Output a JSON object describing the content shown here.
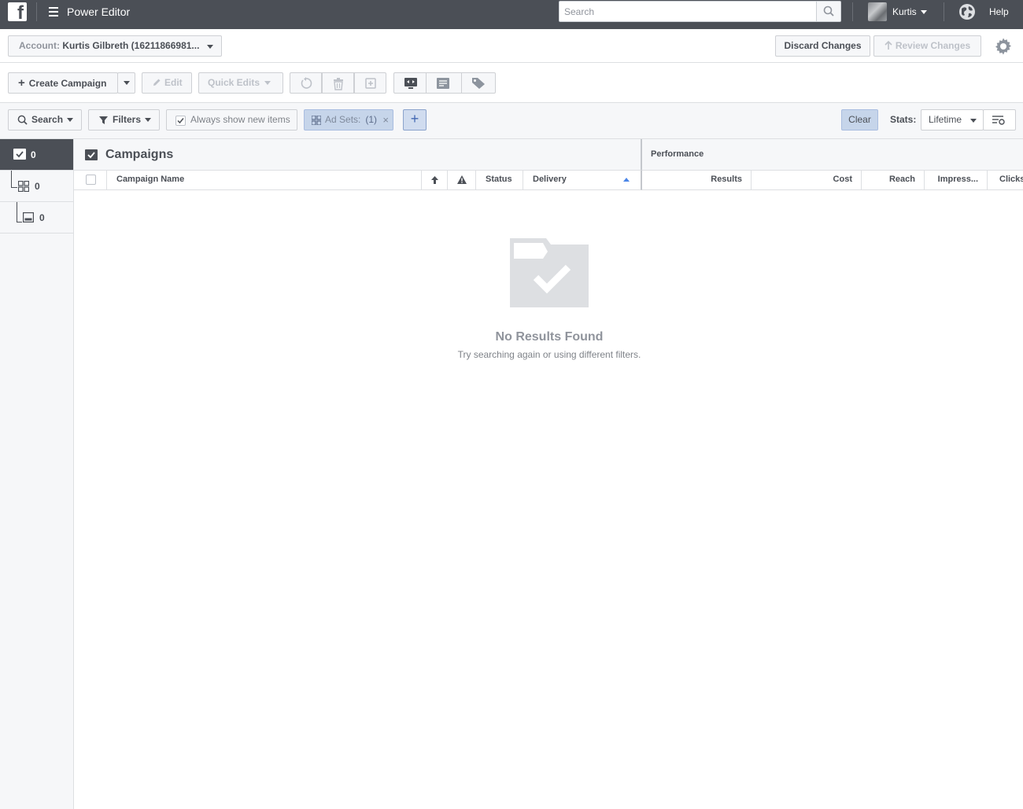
{
  "topbar": {
    "app_title": "Power Editor",
    "search_placeholder": "Search",
    "user_name": "Kurtis",
    "help": "Help"
  },
  "account": {
    "label": "Account:",
    "value": "Kurtis Gilbreth (16211866981...",
    "discard": "Discard Changes",
    "review": "Review Changes"
  },
  "toolbar": {
    "create": "Create Campaign",
    "edit": "Edit",
    "quick_edits": "Quick Edits"
  },
  "filterbar": {
    "search": "Search",
    "filters": "Filters",
    "always_show": "Always show new items",
    "always_show_checked": true,
    "chip_label": "Ad Sets:",
    "chip_count": "(1)",
    "chip_remove": "×",
    "add": "+",
    "clear": "Clear",
    "stats_label": "Stats:",
    "stats_value": "Lifetime"
  },
  "rail": {
    "campaigns_count": "0",
    "adsets_count": "0",
    "ads_count": "0"
  },
  "table": {
    "section_title": "Campaigns",
    "performance_title": "Performance",
    "columns": {
      "name": "Campaign Name",
      "status": "Status",
      "delivery": "Delivery",
      "results": "Results",
      "cost": "Cost",
      "reach": "Reach",
      "impressions": "Impress...",
      "clicks": "Clicks"
    }
  },
  "empty": {
    "title": "No Results Found",
    "subtitle": "Try searching again or using different filters."
  },
  "colors": {
    "topbar_bg": "#4b4f56",
    "chip_bg": "#c6d5ea",
    "accent_blue": "#4267b2"
  }
}
